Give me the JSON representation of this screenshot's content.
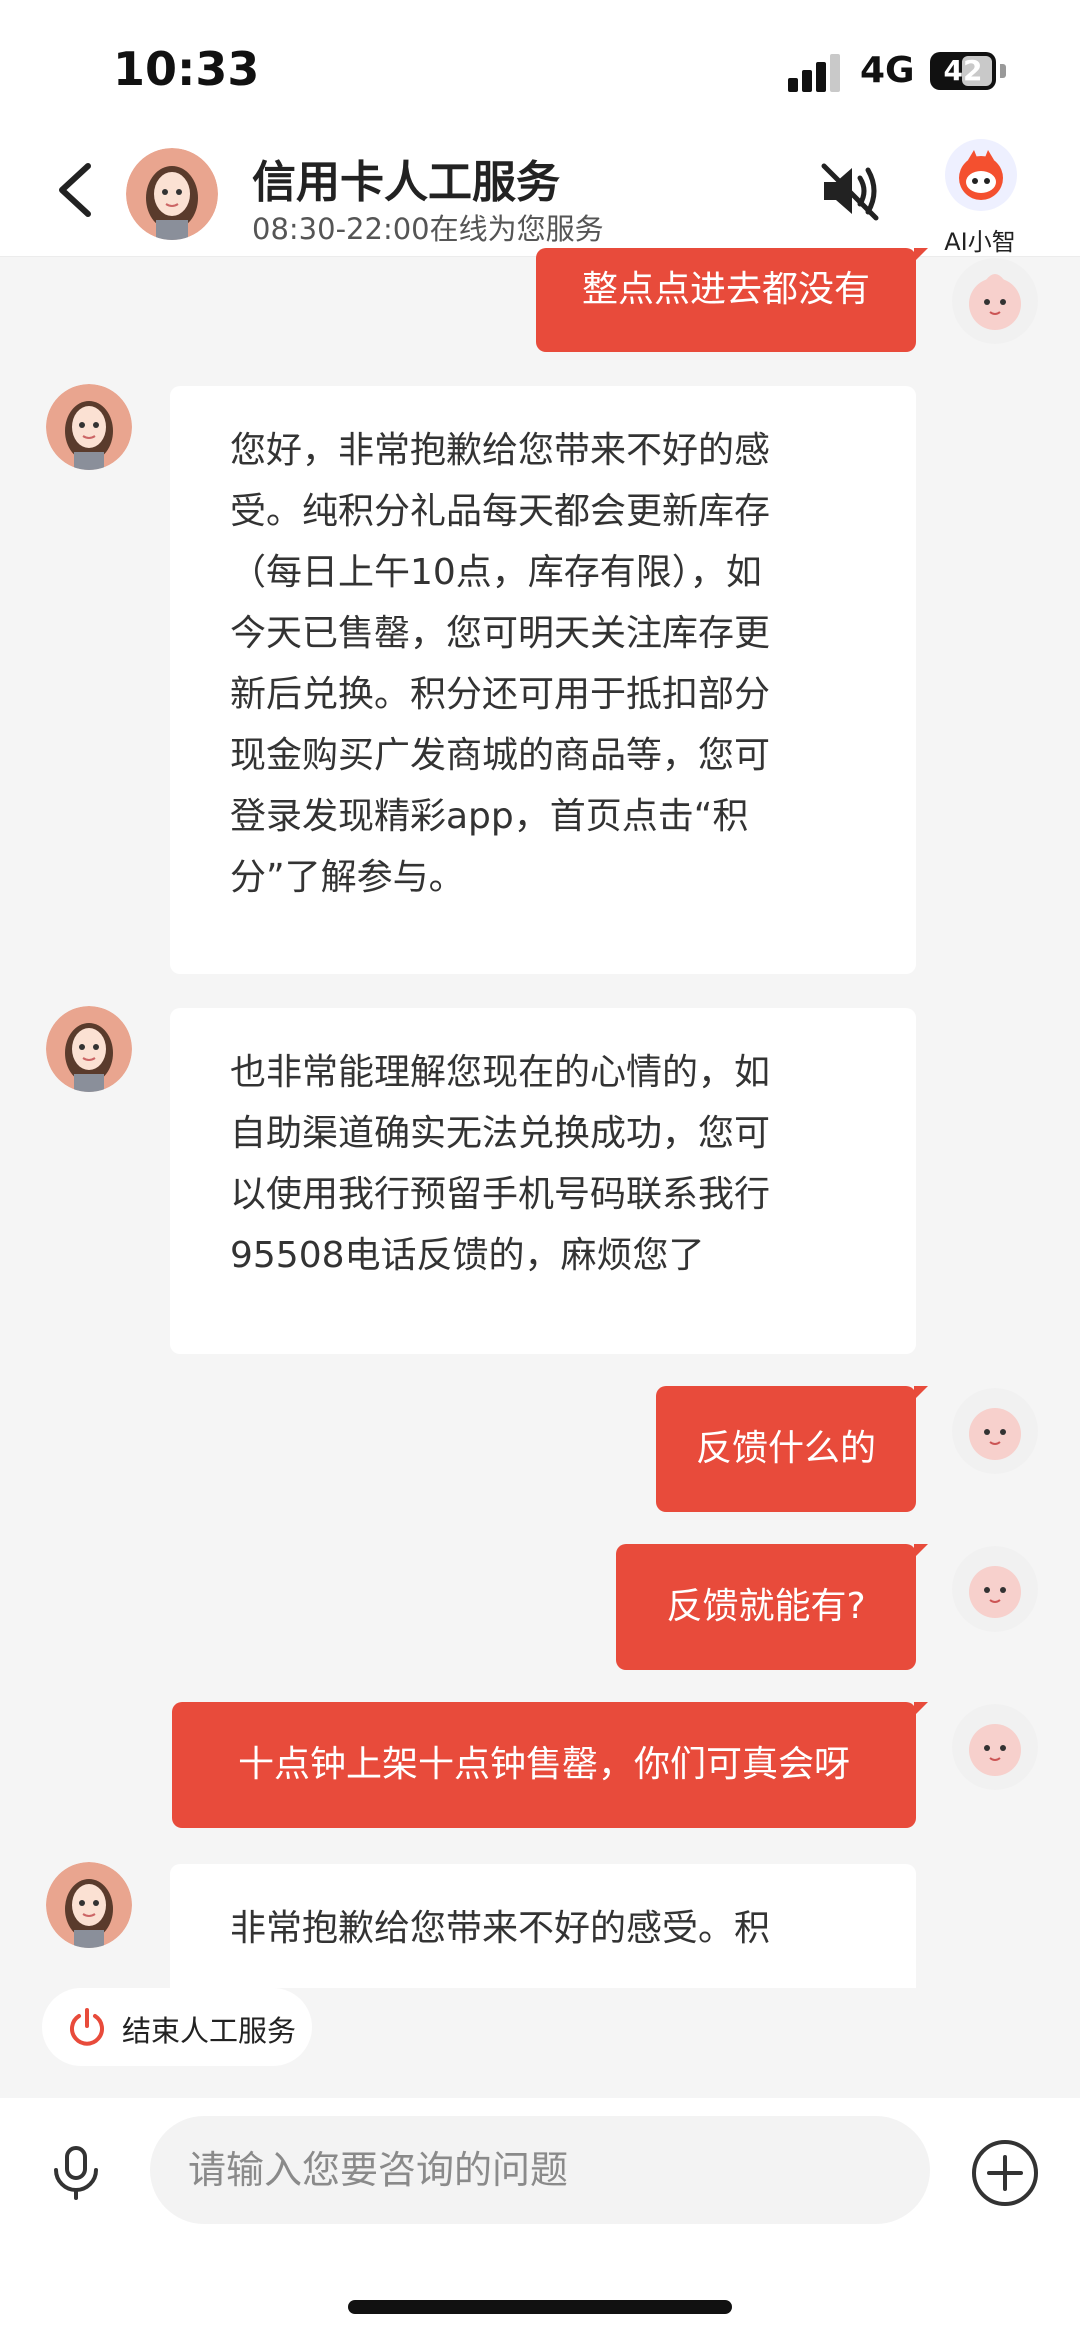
{
  "status_bar": {
    "time": "10:33",
    "network": "4G",
    "battery": "42"
  },
  "header": {
    "title": "信用卡人工服务",
    "subtitle": "08:30-22:00在线为您服务",
    "ai_label": "AI小智"
  },
  "messages": [
    {
      "from": "user",
      "text": "整点点进去都没有"
    },
    {
      "from": "agent",
      "lines": [
        "您好，非常抱歉给您带来不好的感",
        "受。纯积分礼品每天都会更新库存",
        "（每日上午10点，库存有限），如",
        "今天已售罄，您可明天关注库存更",
        "新后兑换。积分还可用于抵扣部分",
        "现金购买广发商城的商品等，您可",
        "登录发现精彩app，首页点击“积",
        "分”了解参与。"
      ]
    },
    {
      "from": "agent",
      "lines": [
        "也非常能理解您现在的心情的，如",
        "自助渠道确实无法兑换成功，您可",
        "以使用我行预留手机号码联系我行",
        "95508电话反馈的，麻烦您了"
      ]
    },
    {
      "from": "user",
      "text": "反馈什么的"
    },
    {
      "from": "user",
      "text": "反馈就能有?"
    },
    {
      "from": "user",
      "text": "十点钟上架十点钟售罄，你们可真会呀"
    },
    {
      "from": "agent",
      "lines": [
        "非常抱歉给您带来不好的感受。积"
      ]
    }
  ],
  "end_service": {
    "label": "结束人工服务"
  },
  "input": {
    "placeholder": "请输入您要咨询的问题"
  },
  "colors": {
    "accent": "#e84b3b",
    "background": "#f5f5f5"
  },
  "icons": [
    "back-arrow-icon",
    "speaker-mute-icon",
    "ai-robot-icon",
    "power-icon",
    "microphone-icon",
    "plus-circle-icon"
  ]
}
